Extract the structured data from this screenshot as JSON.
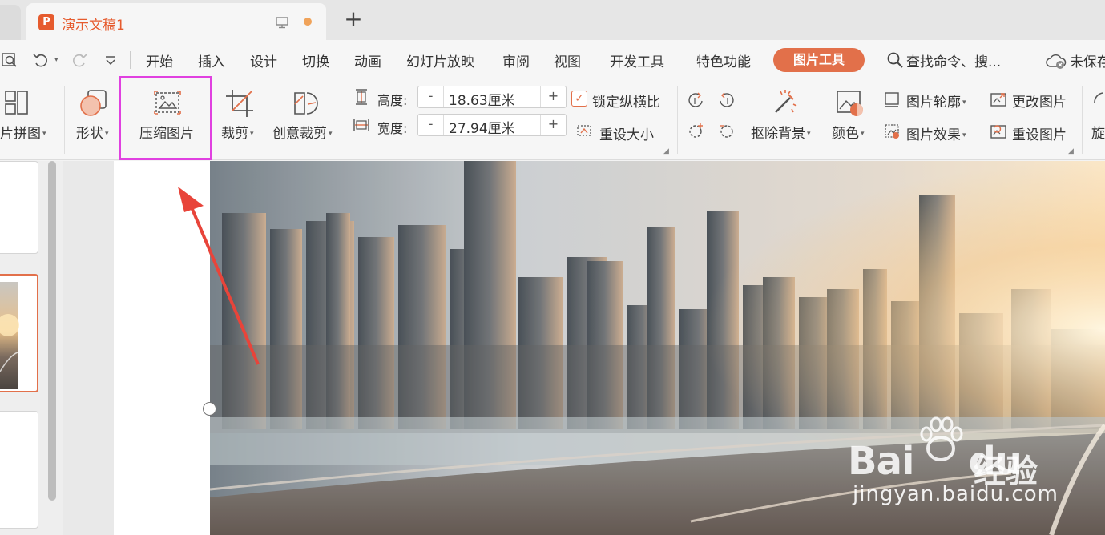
{
  "tabs": {
    "doc_title": "演示文稿1",
    "logo_letter": "P"
  },
  "menu": {
    "items": [
      "开始",
      "插入",
      "设计",
      "切换",
      "动画",
      "幻灯片放映",
      "审阅",
      "视图",
      "开发工具",
      "特色功能"
    ],
    "active": "图片工具",
    "search": "查找命令、搜...",
    "unsaved": "未保存"
  },
  "ribbon": {
    "puzzle": "片拼图",
    "shape": "形状",
    "compress": "压缩图片",
    "crop": "裁剪",
    "creative_crop": "创意裁剪",
    "height_label": "高度:",
    "height_value": "18.63厘米",
    "width_label": "宽度:",
    "width_value": "27.94厘米",
    "minus": "-",
    "plus": "+",
    "lock_ratio": "锁定纵横比",
    "reset_size": "重设大小",
    "remove_bg": "抠除背景",
    "color": "颜色",
    "outline": "图片轮廓",
    "effects": "图片效果",
    "change_pic": "更改图片",
    "reset_pic": "重设图片",
    "rotate": "旋"
  },
  "watermark": {
    "brand": "Bai",
    "brand2": "du",
    "cn": "经验",
    "url": "jingyan.baidu.com"
  },
  "colors": {
    "accent": "#e2704a",
    "highlight": "#e040e0",
    "arrow": "#e8443a"
  }
}
